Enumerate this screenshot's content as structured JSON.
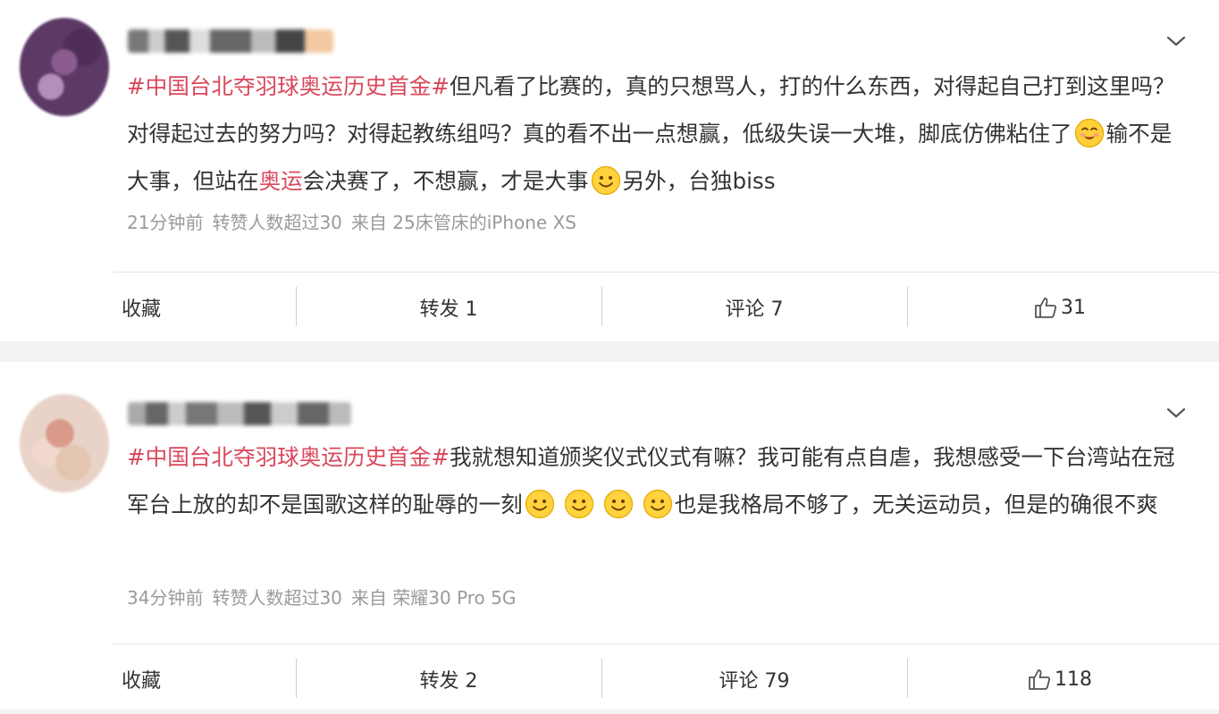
{
  "posts": [
    {
      "topic": "#中国台北夺羽球奥运历史首金#",
      "text_1": "但凡看了比赛的，真的只想骂人，打的什么东西，对得起自己打到这里吗？对得起过去的努力吗？对得起教练组吗？真的看不出一点想赢，低级失误一大堆，脚底仿佛粘住了",
      "text_2": "输不是大事，但站在",
      "highlight": "奥运",
      "text_3": "会决赛了，不想赢，才是大事",
      "text_4": "另外，台独biss",
      "time": "21分钟前",
      "repost_note": "转赞人数超过30",
      "source": "来自 25床管床的iPhone XS",
      "actions": {
        "favorite": "收藏",
        "repost": "转发 1",
        "comment": "评论 7",
        "likes": "31"
      },
      "icons": {
        "menu": "chevron-down-icon",
        "like": "thumbs-up-icon",
        "emoji": "smile-emoji-icon"
      }
    },
    {
      "topic": "#中国台北夺羽球奥运历史首金#",
      "text_1": "我就想知道颁奖仪式仪式有嘛？我可能有点自虐，我想感受一下台湾站在冠军台上放的却不是国歌这样的耻辱的一刻",
      "text_2": "也是我格局不够了，无关运动员，但是的确很不爽",
      "time": "34分钟前",
      "repost_note": "转赞人数超过30",
      "source": "来自 荣耀30 Pro 5G",
      "actions": {
        "favorite": "收藏",
        "repost": "转发 2",
        "comment": "评论 79",
        "likes": "118"
      },
      "icons": {
        "menu": "chevron-down-icon",
        "like": "thumbs-up-icon",
        "emoji": "smile-emoji-icon"
      }
    }
  ],
  "colors": {
    "topic": "#d9485b",
    "meta": "#9a9a9a",
    "text": "#333333"
  }
}
